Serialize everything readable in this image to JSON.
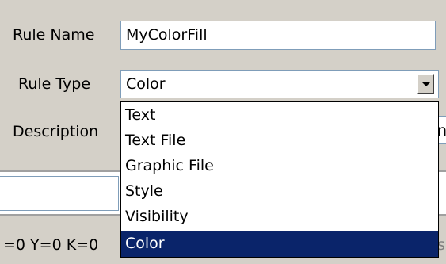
{
  "form": {
    "rule_name_label": "Rule Name",
    "rule_name_value": "MyColorFill",
    "rule_type_label": "Rule Type",
    "rule_type_value": "Color",
    "description_label": "Description",
    "description_value_fragment": "n"
  },
  "dropdown": {
    "options": [
      "Text",
      "Text File",
      "Graphic File",
      "Style",
      "Visibility",
      "Color"
    ],
    "selected": "Color"
  },
  "lower": {
    "coords_text": "=0 Y=0 K=0",
    "right_fragment": "s"
  },
  "colors": {
    "dialog_bg": "#d4d0c8",
    "selection_bg": "#0a246a",
    "field_border": "#7f9db9"
  }
}
